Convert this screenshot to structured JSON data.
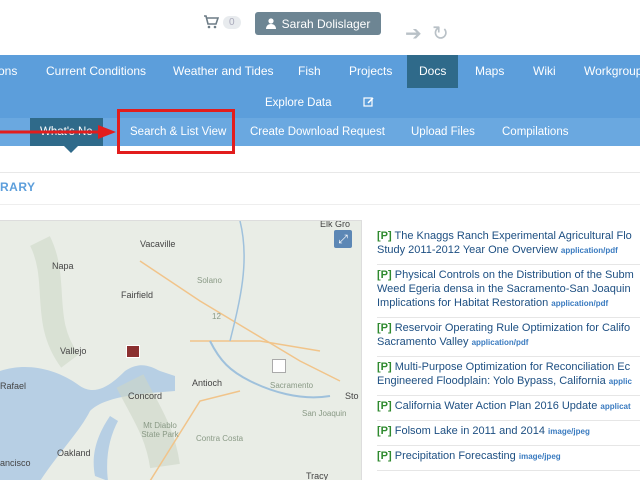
{
  "topbar": {
    "cart_count": "0",
    "user_name": "Sarah Dolislager"
  },
  "main_nav": {
    "items": [
      "ons",
      "Current Conditions",
      "Weather and Tides",
      "Fish",
      "Projects",
      "Docs",
      "Maps",
      "Wiki",
      "Workgroup"
    ]
  },
  "second_nav": {
    "explore": "Explore Data"
  },
  "third_nav": {
    "items": [
      "What's Ne",
      "Search & List View",
      "Create Download Request",
      "Upload Files",
      "Compilations"
    ]
  },
  "section_title": "RARY",
  "map": {
    "labels": [
      "Vacaville",
      "Napa",
      "Fairfield",
      "Vallejo",
      "Rafael",
      "Concord",
      "Antioch",
      "Oakland",
      "ancisco",
      "Tracy",
      "Solano",
      "Sacramento",
      "San Joaquin",
      "Contra Costa",
      "Mt Diablo State Park",
      "Elk Gro",
      "Sto",
      "12"
    ]
  },
  "results": [
    {
      "tag": "[P]",
      "title": "The Knaggs Ranch Experimental Agricultural Flo",
      "title2": "Study 2011-2012 Year One Overview",
      "mime": "application/pdf"
    },
    {
      "tag": "[P]",
      "title": "Physical Controls on the Distribution of the Subm",
      "title2": "Weed Egeria densa in the Sacramento-San Joaquin",
      "title3": "Implications for Habitat Restoration",
      "mime": "application/pdf"
    },
    {
      "tag": "[P]",
      "title": "Reservoir Operating Rule Optimization for Califo",
      "title2": "Sacramento Valley",
      "mime": "application/pdf"
    },
    {
      "tag": "[P]",
      "title": "Multi-Purpose Optimization for Reconciliation Ec",
      "title2": "Engineered Floodplain: Yolo Bypass, California",
      "mime": "applic"
    },
    {
      "tag": "[P]",
      "title": "California Water Action Plan 2016 Update",
      "mime": "applicat"
    },
    {
      "tag": "[P]",
      "title": "Folsom Lake in 2011 and 2014",
      "mime": "image/jpeg"
    },
    {
      "tag": "[P]",
      "title": "Precipitation Forecasting",
      "mime": "image/jpeg"
    }
  ],
  "colors": {
    "nav_blue": "#5c9edb",
    "nav_active": "#2f6a8a",
    "highlight_red": "#e21d1d"
  }
}
